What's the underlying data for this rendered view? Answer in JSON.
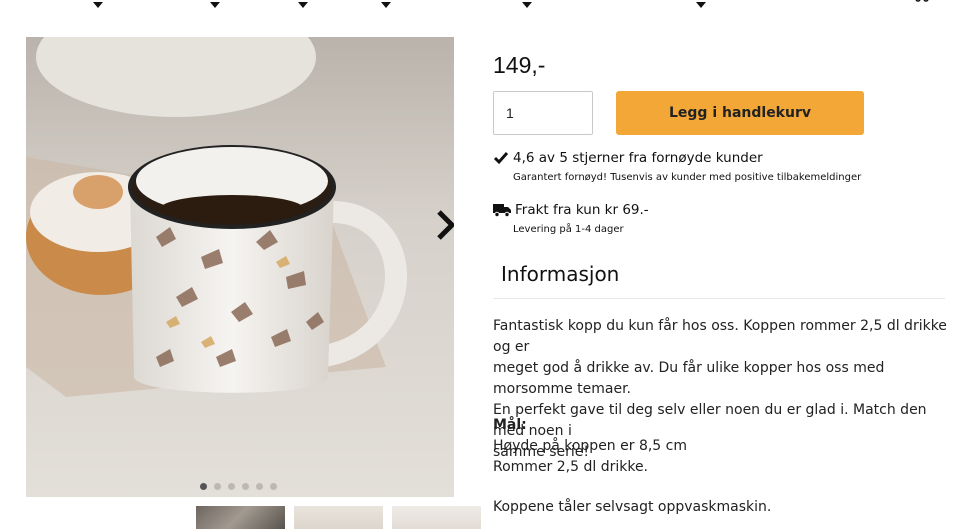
{
  "nav": {
    "menu_count": 6
  },
  "icons": {
    "cart": "shopping-cart-icon",
    "check": "checkmark-icon",
    "truck": "delivery-truck-icon",
    "next": "chevron-right-icon",
    "caret": "caret-down-icon"
  },
  "gallery": {
    "image_alt": "Kopp med sommerfugler",
    "dot_count": 6,
    "active_dot": 1,
    "thumb_count": 3
  },
  "product": {
    "price": "149,-",
    "quantity": "1",
    "add_to_cart_label": "Legg i handlekurv"
  },
  "usps": [
    {
      "title": "4,6 av 5 stjerner fra fornøyde kunder",
      "subtitle": "Garantert fornøyd! Tusenvis av kunder med positive tilbakemeldinger"
    },
    {
      "title": "Frakt fra kun kr 69.-",
      "subtitle": "Levering på 1-4 dager"
    }
  ],
  "info": {
    "title": "Informasjon",
    "description_lines": [
      "Fantastisk kopp du kun får hos oss. Koppen rommer 2,5 dl drikke og er",
      "meget god å drikke av. Du får ulike kopper hos oss med morsomme temaer.",
      "En perfekt gave til deg selv eller noen du er glad i. Match den med noen i",
      "samme serie!"
    ],
    "measure_label": "Mål:",
    "measure_lines": [
      "Høyde på koppen er 8,5 cm",
      "Rommer 2,5 dl drikke."
    ],
    "dishwasher": "Koppene tåler selvsagt oppvaskmaskin."
  },
  "colors": {
    "accent": "#f2a736",
    "text": "#222222"
  }
}
